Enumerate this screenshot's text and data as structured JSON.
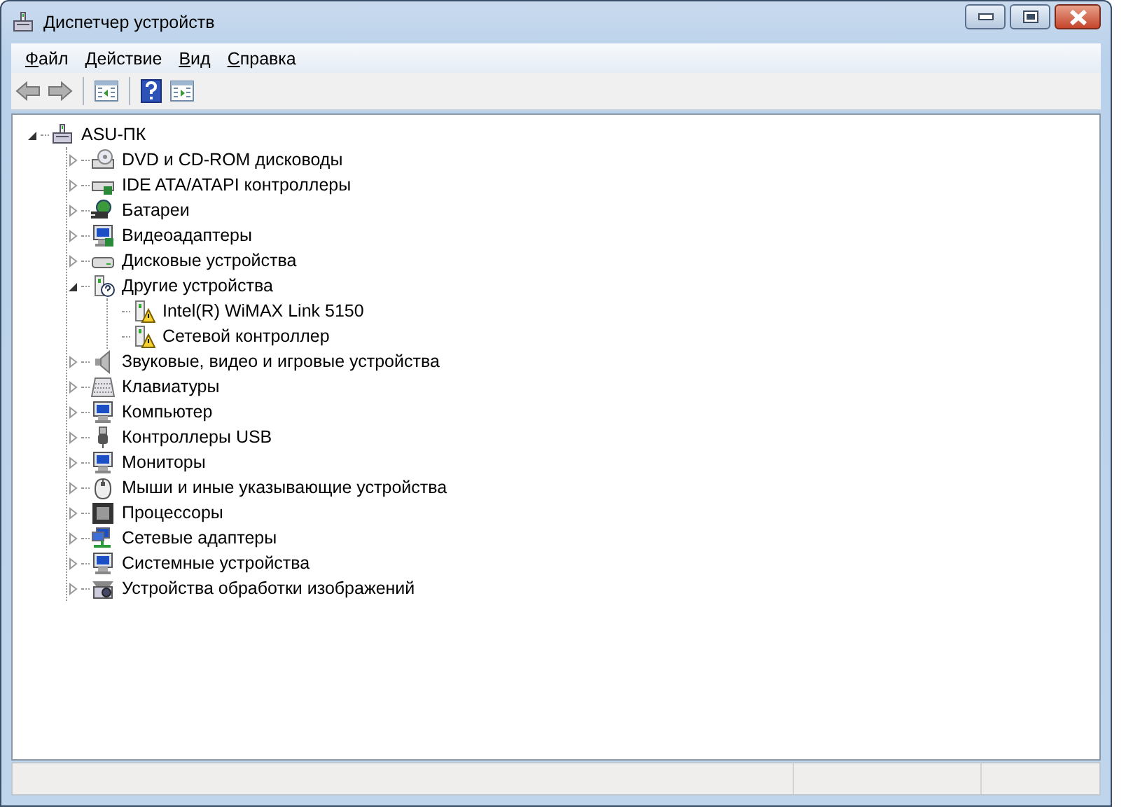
{
  "window": {
    "title": "Диспетчер устройств"
  },
  "menu": [
    "Файл",
    "Действие",
    "Вид",
    "Справка"
  ],
  "tree": [
    {
      "label": "ASU-ПК",
      "expanded": true,
      "children": [
        {
          "label": "DVD и CD-ROM дисководы",
          "expanded": false
        },
        {
          "label": "IDE ATA/ATAPI контроллеры",
          "expanded": false
        },
        {
          "label": "Батареи",
          "expanded": false
        },
        {
          "label": "Видеоадаптеры",
          "expanded": false
        },
        {
          "label": "Дисковые устройства",
          "expanded": false
        },
        {
          "label": "Другие устройства",
          "expanded": true,
          "children": [
            {
              "label": "Intel(R) WiMAX Link 5150",
              "warning": true
            },
            {
              "label": "Сетевой контроллер",
              "warning": true
            }
          ]
        },
        {
          "label": "Звуковые, видео и игровые устройства",
          "expanded": false
        },
        {
          "label": "Клавиатуры",
          "expanded": false
        },
        {
          "label": "Компьютер",
          "expanded": false
        },
        {
          "label": "Контроллеры USB",
          "expanded": false
        },
        {
          "label": "Мониторы",
          "expanded": false
        },
        {
          "label": "Мыши и иные указывающие устройства",
          "expanded": false
        },
        {
          "label": "Процессоры",
          "expanded": false
        },
        {
          "label": "Сетевые адаптеры",
          "expanded": false
        },
        {
          "label": "Системные устройства",
          "expanded": false
        },
        {
          "label": "Устройства обработки изображений",
          "expanded": false
        }
      ]
    }
  ]
}
